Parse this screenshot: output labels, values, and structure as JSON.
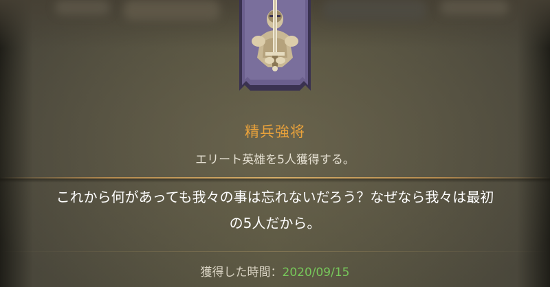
{
  "achievement": {
    "title": "精兵強将",
    "subtitle": "エリート英雄を5人獲得する。",
    "description_line1": "これから何があっても我々の事は忘れないだろう？なぜなら我々は最初",
    "description_line2": "の5人だから。",
    "obtained_label": "獲得した時間：",
    "obtained_date": "2020/09/15",
    "badge_icon": "knight-with-sword-icon"
  },
  "colors": {
    "title": "#e9a23b",
    "date": "#77c85b",
    "badge_frame": "#6b5f8d",
    "text": "#ffffff"
  }
}
